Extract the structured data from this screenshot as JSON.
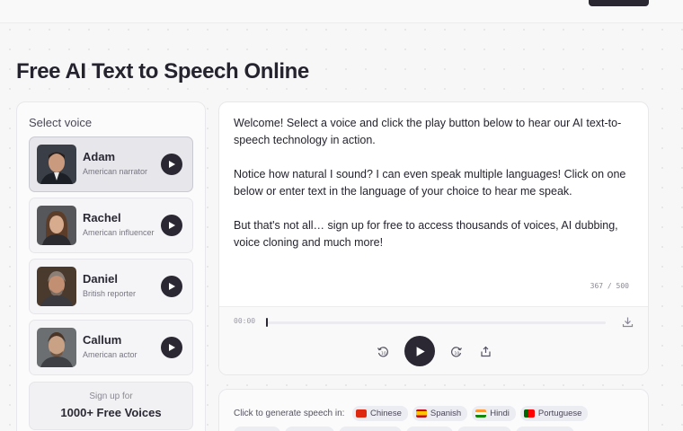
{
  "page": {
    "title": "Free AI Text to Speech Online"
  },
  "voice_panel": {
    "title": "Select voice",
    "voices": [
      {
        "name": "Adam",
        "desc": "American narrator",
        "selected": true
      },
      {
        "name": "Rachel",
        "desc": "American influencer",
        "selected": false
      },
      {
        "name": "Daniel",
        "desc": "British reporter",
        "selected": false
      },
      {
        "name": "Callum",
        "desc": "American actor",
        "selected": false
      }
    ],
    "signup": {
      "top": "Sign up for",
      "main": "1000+ Free Voices"
    }
  },
  "editor": {
    "paragraphs": [
      "Welcome! Select a voice and click the play button below to hear our AI text-to-speech technology in action.",
      "Notice how natural I sound? I can even speak multiple languages! Click on one below or enter text in the language of your choice to hear me speak.",
      "But that's not all… sign up for free to access thousands of voices, AI dubbing, voice cloning and much more!"
    ],
    "char_count": "367 / 500"
  },
  "player": {
    "time": "00:00",
    "progress": 0
  },
  "languages": {
    "label": "Click to generate speech in:",
    "chips": [
      {
        "label": "Chinese",
        "color": "#de2910"
      },
      {
        "label": "Spanish",
        "color": "#c60b1e"
      },
      {
        "label": "Hindi",
        "color": "#ff9933"
      },
      {
        "label": "Portuguese",
        "color": "#006600"
      }
    ]
  },
  "colors": {
    "accent": "#2b2833",
    "background": "#f7f7f8"
  }
}
